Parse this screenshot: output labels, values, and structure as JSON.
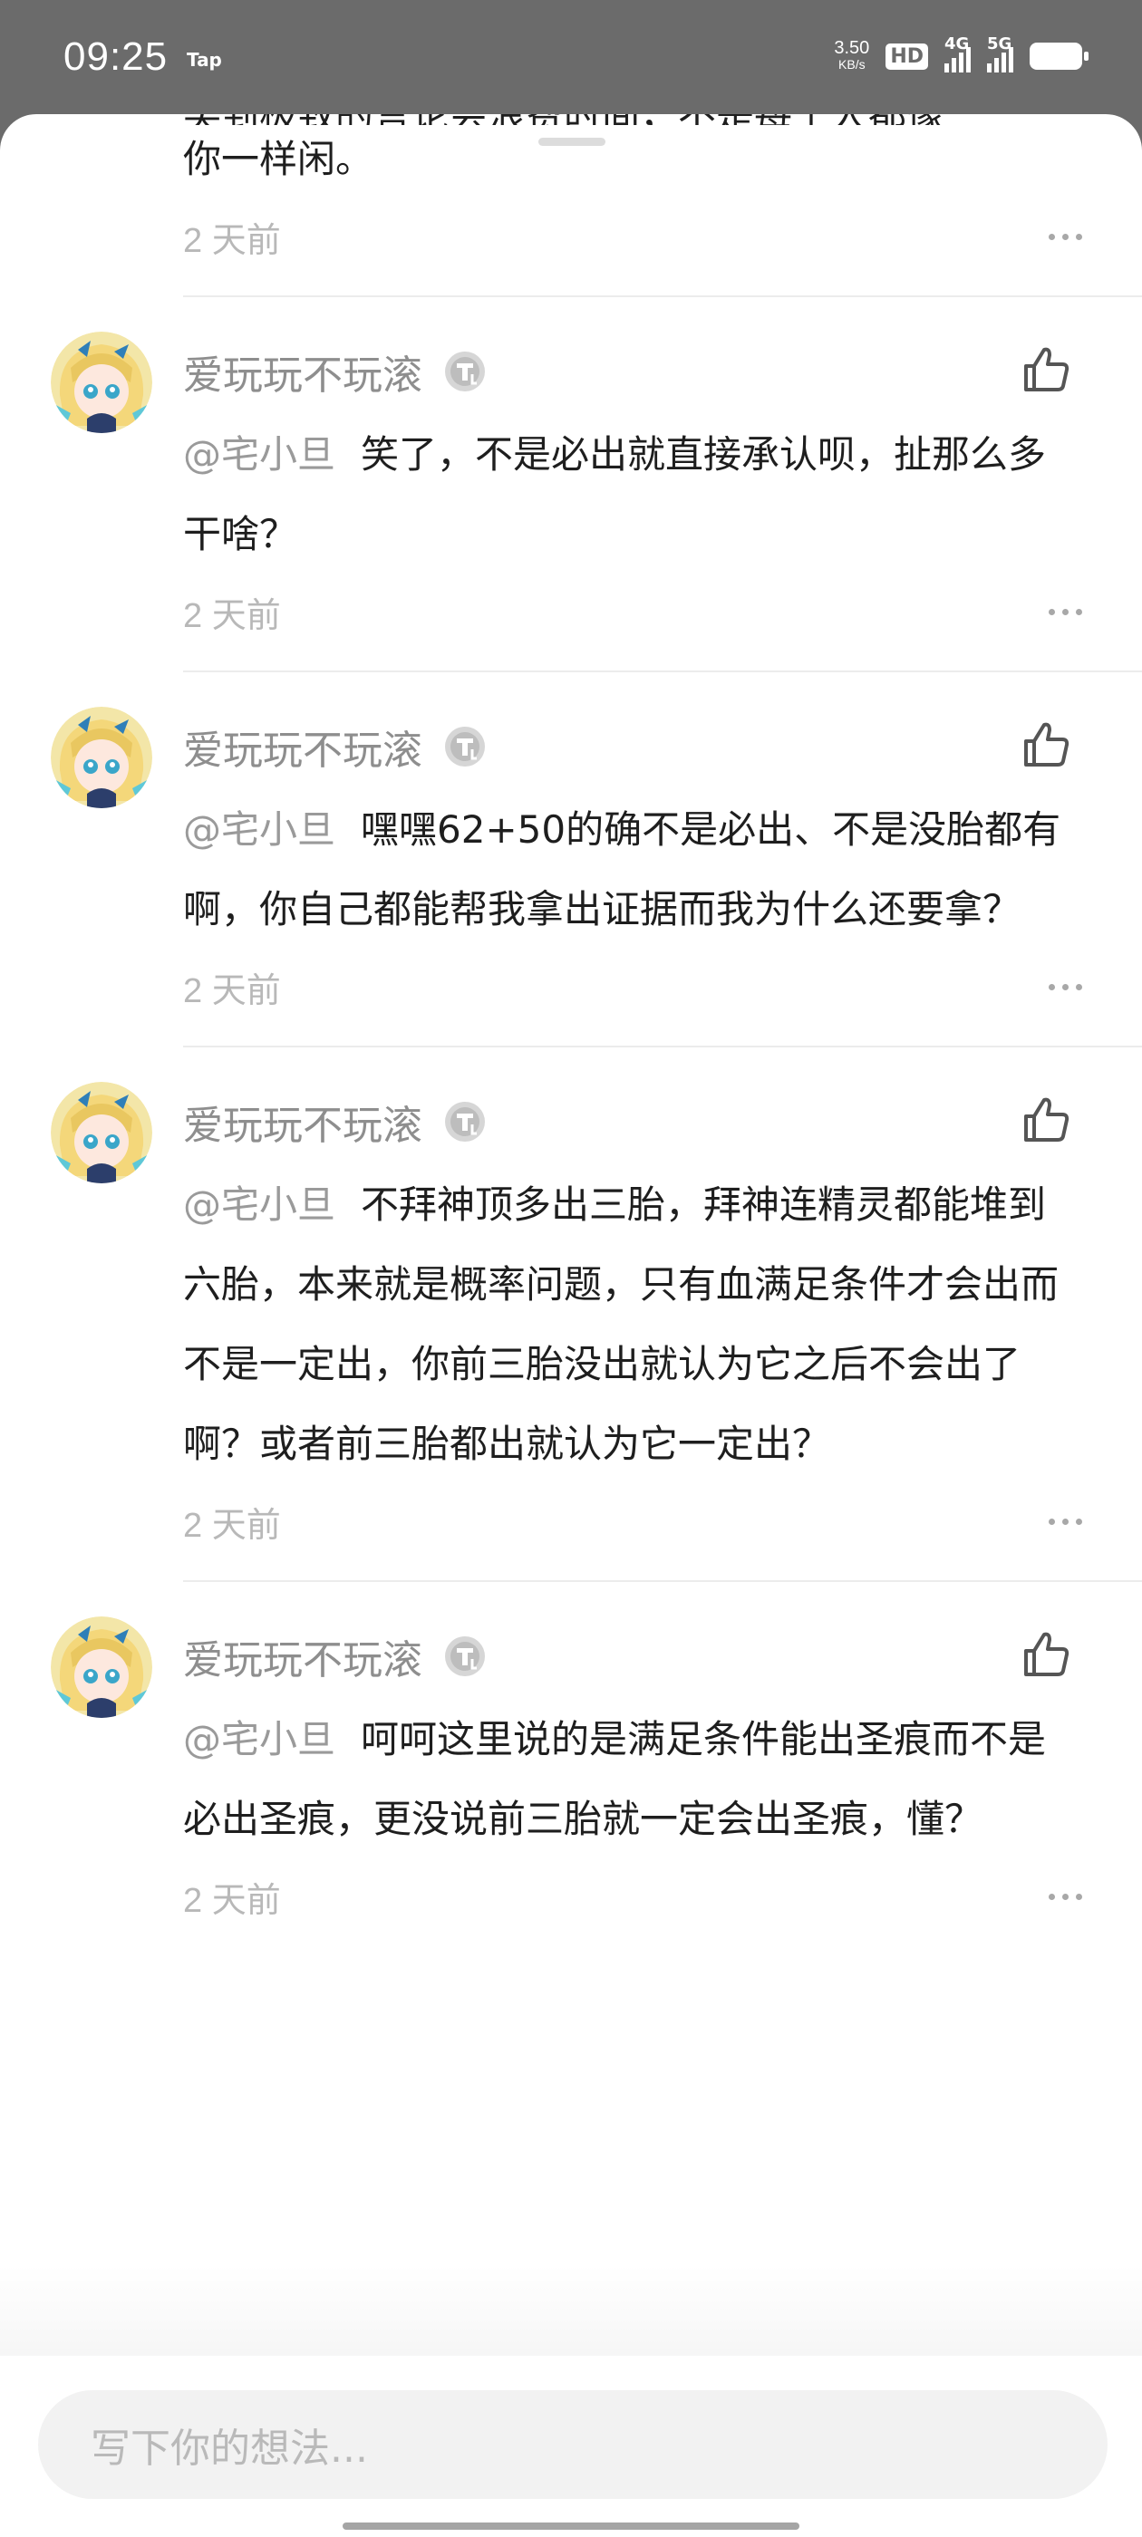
{
  "status_bar": {
    "time": "09:25",
    "app_indicator": "Tap",
    "net_speed_value": "3.50",
    "net_speed_unit": "KB/s",
    "hd_label": "HD",
    "sim1_label": "4G",
    "sim2_label": "5G",
    "icons": [
      "hd-icon",
      "signal-4g-icon",
      "signal-5g-icon",
      "battery-icon"
    ]
  },
  "partial_comment": {
    "text_cut": "笑到极致的言论会浪费时间，不是每个人都像",
    "text": "你一样闲。",
    "time": "2 天前"
  },
  "comments": [
    {
      "username": "爱玩玩不玩滚",
      "mention": "@宅小旦",
      "text": "笑了，不是必出就直接承认呗，扯那么多干啥？",
      "time": "2 天前"
    },
    {
      "username": "爱玩玩不玩滚",
      "mention": "@宅小旦",
      "text": "嘿嘿62+50的确不是必出、不是没胎都有啊，你自己都能帮我拿出证据而我为什么还要拿？",
      "time": "2 天前"
    },
    {
      "username": "爱玩玩不玩滚",
      "mention": "@宅小旦",
      "text": "不拜神顶多出三胎，拜神连精灵都能堆到六胎，本来就是概率问题，只有血满足条件才会出而不是一定出，你前三胎没出就认为它之后不会出了啊？或者前三胎都出就认为它一定出？",
      "time": "2 天前"
    },
    {
      "username": "爱玩玩不玩滚",
      "mention": "@宅小旦",
      "text": "呵呵这里说的是满足条件能出圣痕而不是必出圣痕，更没说前三胎就一定会出圣痕，懂？",
      "time": "2 天前"
    }
  ],
  "input": {
    "placeholder": "写下你的想法..."
  },
  "colors": {
    "status_bar_bg": "#6b6b6b",
    "username": "#8e8e8e",
    "mention": "#9a9a9a",
    "body_text": "#1e1e1e",
    "meta_text": "#b8b8b8",
    "input_bg": "#f2f2f2"
  }
}
